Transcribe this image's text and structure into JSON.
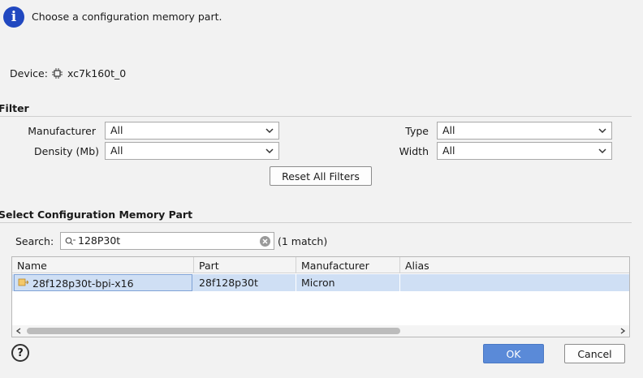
{
  "header": {
    "message": "Choose a configuration memory part."
  },
  "device": {
    "label": "Device:",
    "value": "xc7k160t_0"
  },
  "filter": {
    "title": "Filter",
    "manufacturer_label": "Manufacturer",
    "manufacturer_value": "All",
    "density_label": "Density (Mb)",
    "density_value": "All",
    "type_label": "Type",
    "type_value": "All",
    "width_label": "Width",
    "width_value": "All",
    "reset_label": "Reset All Filters"
  },
  "select": {
    "title": "Select Configuration Memory Part",
    "search_label": "Search:",
    "search_value": "128P30t",
    "match_text": "(1 match)",
    "columns": [
      "Name",
      "Part",
      "Manufacturer",
      "Alias"
    ],
    "rows": [
      {
        "name": "28f128p30t-bpi-x16",
        "part": "28f128p30t",
        "manufacturer": "Micron",
        "alias": ""
      }
    ]
  },
  "footer": {
    "help": "?",
    "ok_label": "OK",
    "cancel_label": "Cancel"
  },
  "colors": {
    "info": "#2148c0",
    "selection": "#cfdff4",
    "primary_button": "#5a8ad8"
  },
  "icons": [
    "info-icon",
    "chip-icon",
    "chevron-down-icon",
    "search-icon",
    "clear-icon",
    "memory-part-icon",
    "scroll-left-icon",
    "scroll-right-icon",
    "help-icon"
  ]
}
